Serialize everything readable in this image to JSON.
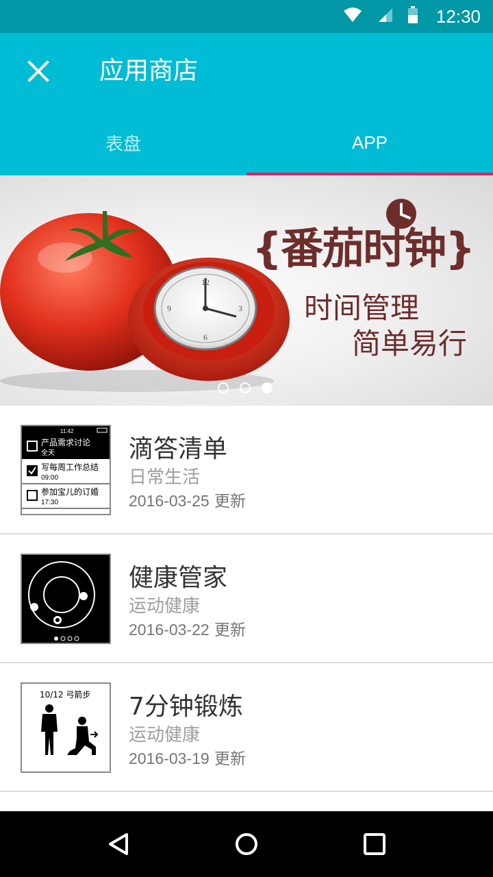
{
  "status_bar": {
    "time": "12:30"
  },
  "app_bar": {
    "title": "应用商店"
  },
  "tabs": [
    {
      "label": "表盘",
      "active": false
    },
    {
      "label": "APP",
      "active": true
    }
  ],
  "banner": {
    "title": "{番茄时钟}",
    "line1": "时间管理",
    "line2": "简单易行",
    "page_count": 3,
    "active_page": 3
  },
  "apps": [
    {
      "name": "滴答清单",
      "category": "日常生活",
      "date": "2016-03-25",
      "update_suffix": "更新",
      "thumb": {
        "time": "11:42",
        "tasks": [
          {
            "title": "产品需求讨论",
            "sub": "全天",
            "checked": false,
            "highlighted": true
          },
          {
            "title": "写每周工作总结",
            "sub": "09:00",
            "checked": true,
            "highlighted": false
          },
          {
            "title": "参加宝儿的订婚",
            "sub": "17:30",
            "checked": false,
            "highlighted": false
          }
        ]
      }
    },
    {
      "name": "健康管家",
      "category": "运动健康",
      "date": "2016-03-22",
      "update_suffix": "更新"
    },
    {
      "name": "7分钟锻炼",
      "category": "运动健康",
      "date": "2016-03-19",
      "update_suffix": "更新",
      "thumb": {
        "caption": "10/12 弓箭步"
      }
    }
  ],
  "colors": {
    "status_bar": "#0097a7",
    "app_bar": "#00bcd4",
    "tab_indicator": "#e91e63",
    "banner_text": "#6d2d2b"
  },
  "icons": {
    "status": [
      "wifi-icon",
      "signal-icon",
      "battery-icon"
    ],
    "nav": [
      "back-icon",
      "home-icon",
      "recents-icon"
    ]
  }
}
